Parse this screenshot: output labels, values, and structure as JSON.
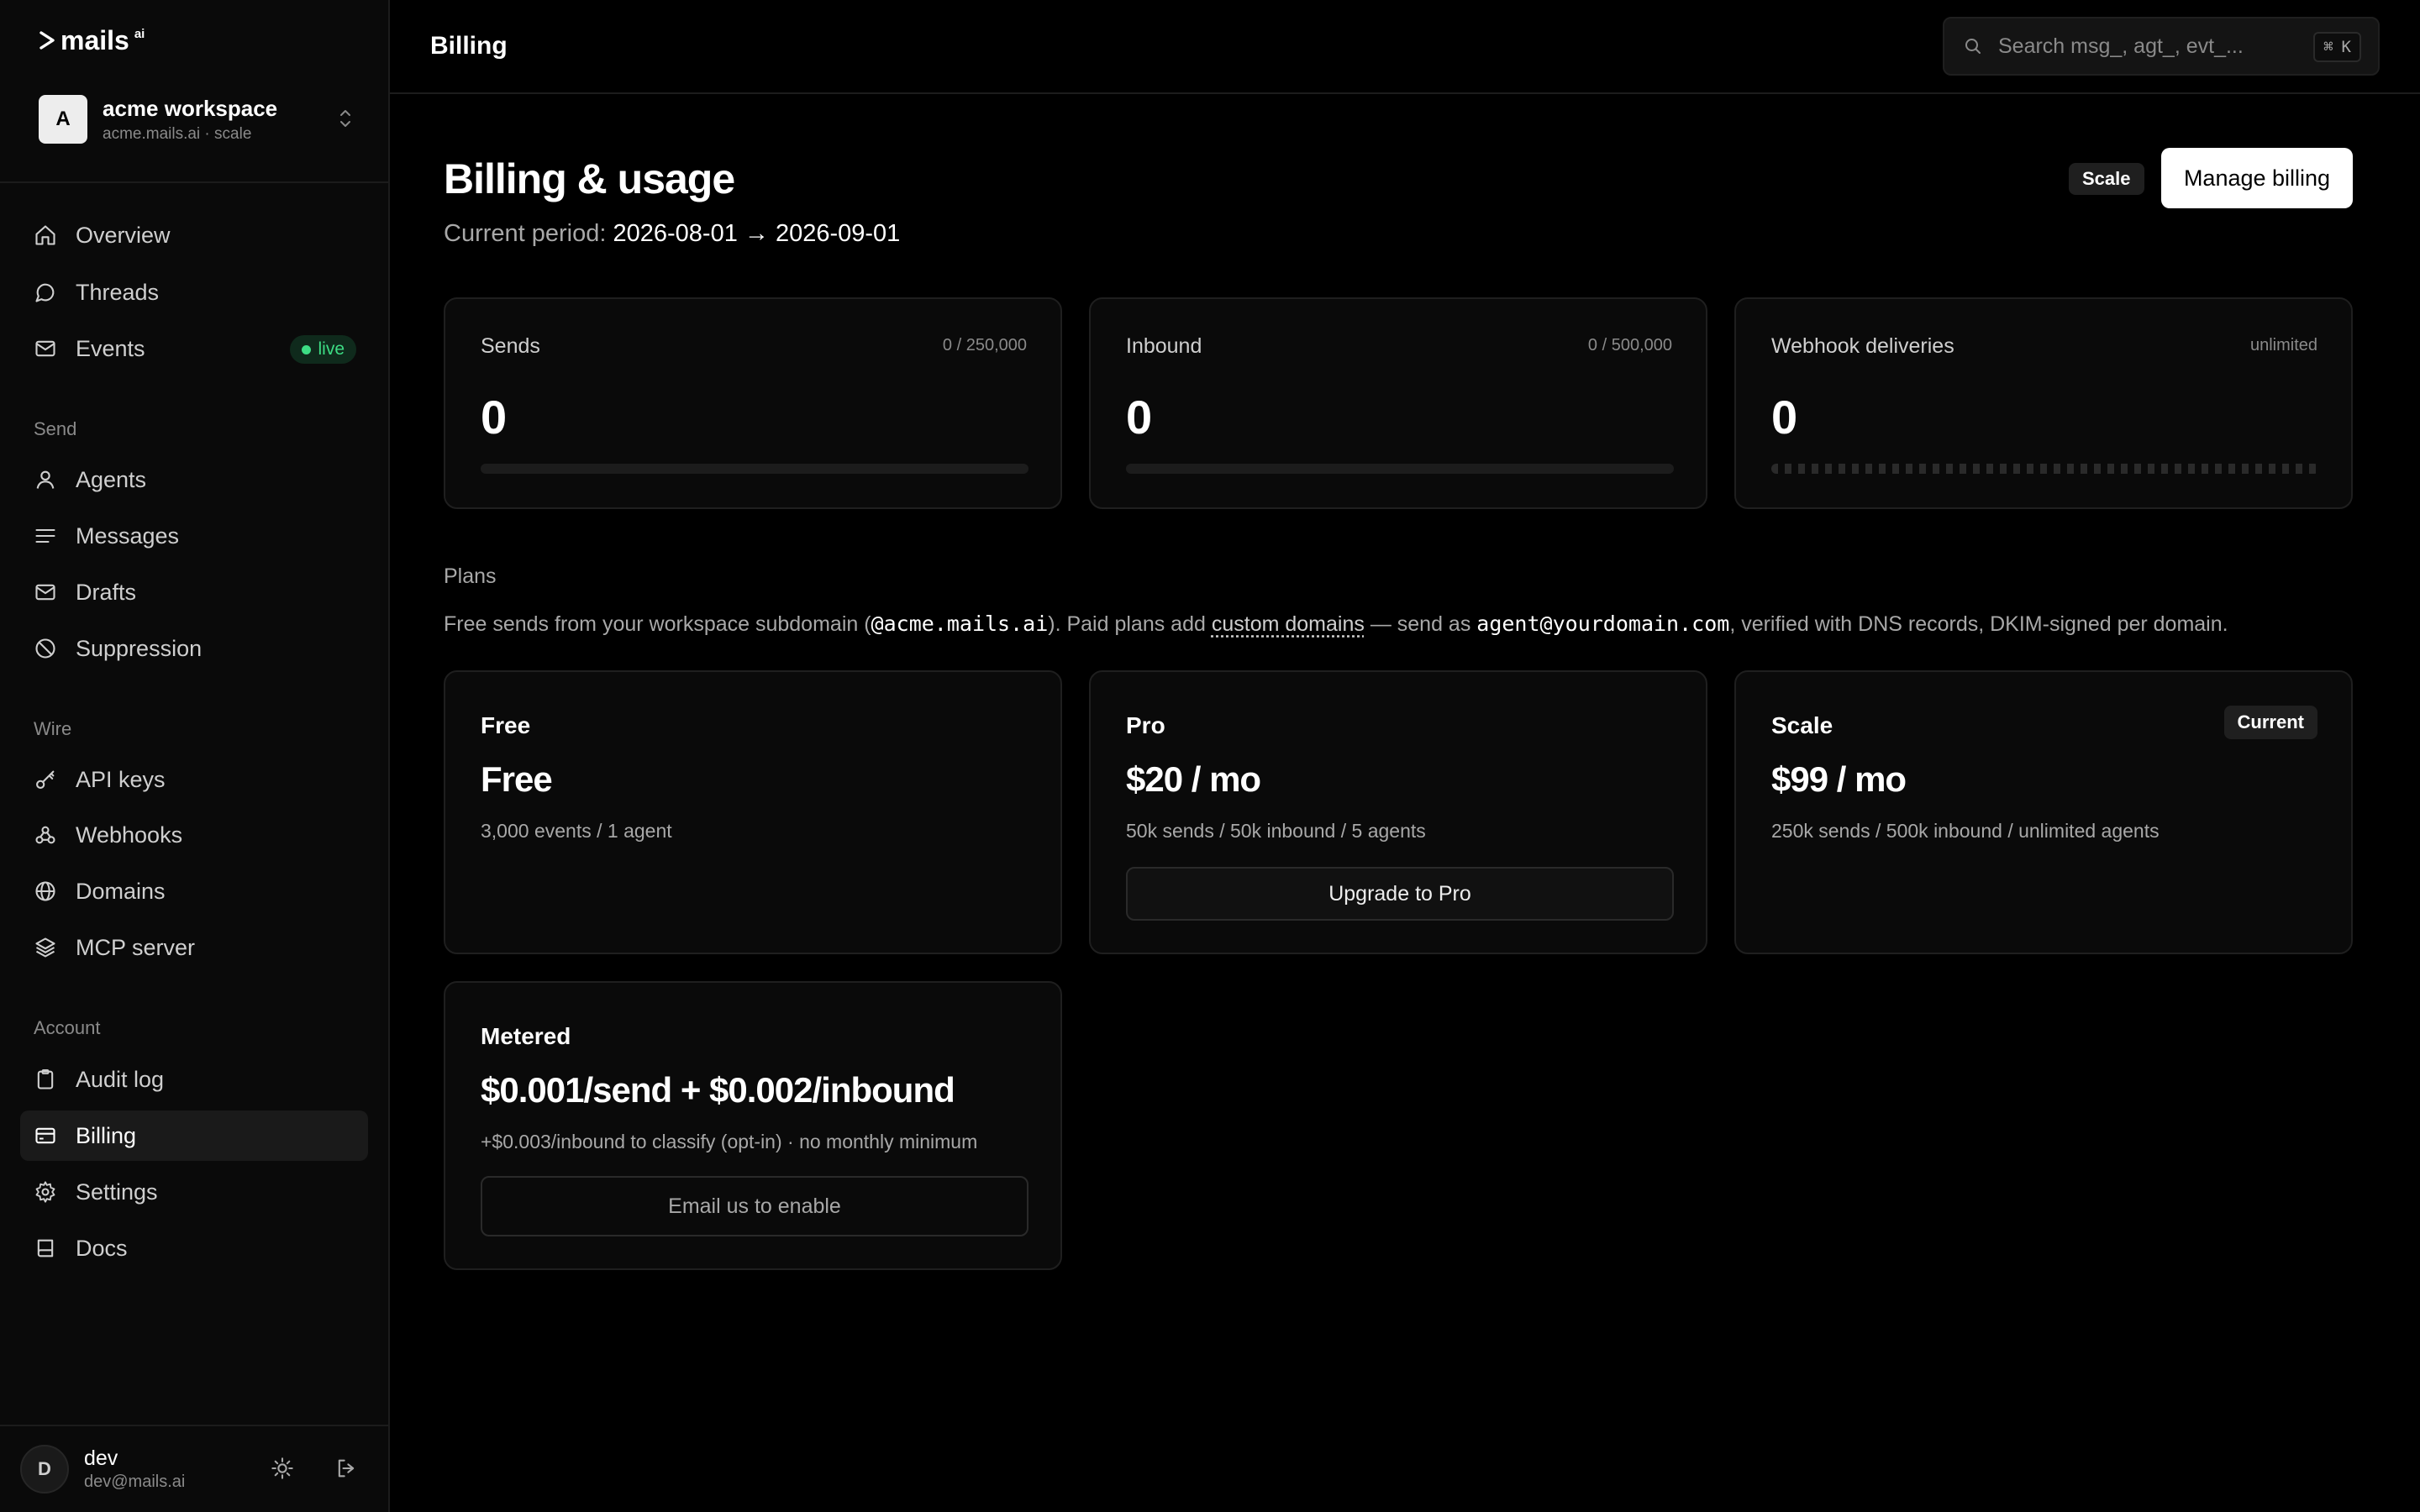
{
  "brand": {
    "logo": "mails",
    "logo_sup": "ai"
  },
  "workspace": {
    "avatar": "A",
    "name": "acme workspace",
    "subtitle": "acme.mails.ai · scale"
  },
  "nav": {
    "overview": "Overview",
    "threads": "Threads",
    "events": "Events",
    "events_badge": "live",
    "send_section": "Send",
    "agents": "Agents",
    "messages": "Messages",
    "drafts": "Drafts",
    "suppression": "Suppression",
    "wire_section": "Wire",
    "api_keys": "API keys",
    "webhooks": "Webhooks",
    "domains": "Domains",
    "mcp_server": "MCP server",
    "account_section": "Account",
    "audit_log": "Audit log",
    "billing": "Billing",
    "settings": "Settings",
    "docs": "Docs"
  },
  "user": {
    "avatar": "D",
    "name": "dev",
    "email": "dev@mails.ai"
  },
  "header": {
    "title": "Billing",
    "search_placeholder": "Search msg_, agt_, evt_...",
    "shortcut_cmd": "⌘",
    "shortcut_key": "K"
  },
  "page": {
    "title": "Billing & usage",
    "period_label": "Current period:",
    "period_start": "2026-08-01",
    "period_arrow": "→",
    "period_end": "2026-09-01",
    "plan_badge": "Scale",
    "manage_button": "Manage billing"
  },
  "usage": [
    {
      "label": "Sends",
      "limit": "0 / 250,000",
      "value": "0",
      "progress": 0
    },
    {
      "label": "Inbound",
      "limit": "0 / 500,000",
      "value": "0",
      "progress": 0
    },
    {
      "label": "Webhook deliveries",
      "limit": "unlimited",
      "value": "0"
    }
  ],
  "plans_section": {
    "label": "Plans",
    "desc_1": "Free sends from your workspace subdomain (",
    "desc_code_1": "@acme.mails.ai",
    "desc_2": "). Paid plans add ",
    "desc_link": "custom domains",
    "desc_3": " — send as ",
    "desc_code_2": "agent@yourdomain.com",
    "desc_4": ", verified with DNS records, DKIM-signed per domain."
  },
  "plans": {
    "free": {
      "name": "Free",
      "price": "Free",
      "desc": "3,000 events / 1 agent"
    },
    "pro": {
      "name": "Pro",
      "price": "$20 / mo",
      "desc": "50k sends / 50k inbound / 5 agents",
      "button": "Upgrade to Pro"
    },
    "scale": {
      "name": "Scale",
      "price": "$99 / mo",
      "desc": "250k sends / 500k inbound / unlimited agents",
      "badge": "Current"
    },
    "metered": {
      "name": "Metered",
      "price": "$0.001/send + $0.002/inbound",
      "desc": "+$0.003/inbound to classify (opt-in) · no monthly minimum",
      "button": "Email us to enable"
    }
  },
  "colors": {
    "background": "#000000",
    "surface": "#0a0a0a",
    "border": "#1f1f1f",
    "live": "#3ddc84",
    "primary_button": "#ffffff"
  }
}
